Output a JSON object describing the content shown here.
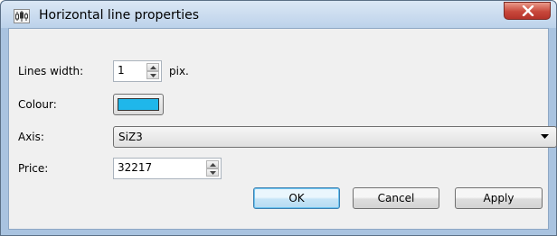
{
  "window": {
    "title": "Horizontal line properties",
    "app_icon": "chart-app-icon",
    "close_icon": "close-icon"
  },
  "form": {
    "lines_width": {
      "label": "Lines width:",
      "value": "1",
      "unit": "pix."
    },
    "colour": {
      "label": "Colour:",
      "value": "#1fb7ea"
    },
    "axis": {
      "label": "Axis:",
      "value": "SiZ3"
    },
    "price": {
      "label": "Price:",
      "value": "32217"
    }
  },
  "buttons": {
    "ok": "OK",
    "cancel": "Cancel",
    "apply": "Apply"
  }
}
